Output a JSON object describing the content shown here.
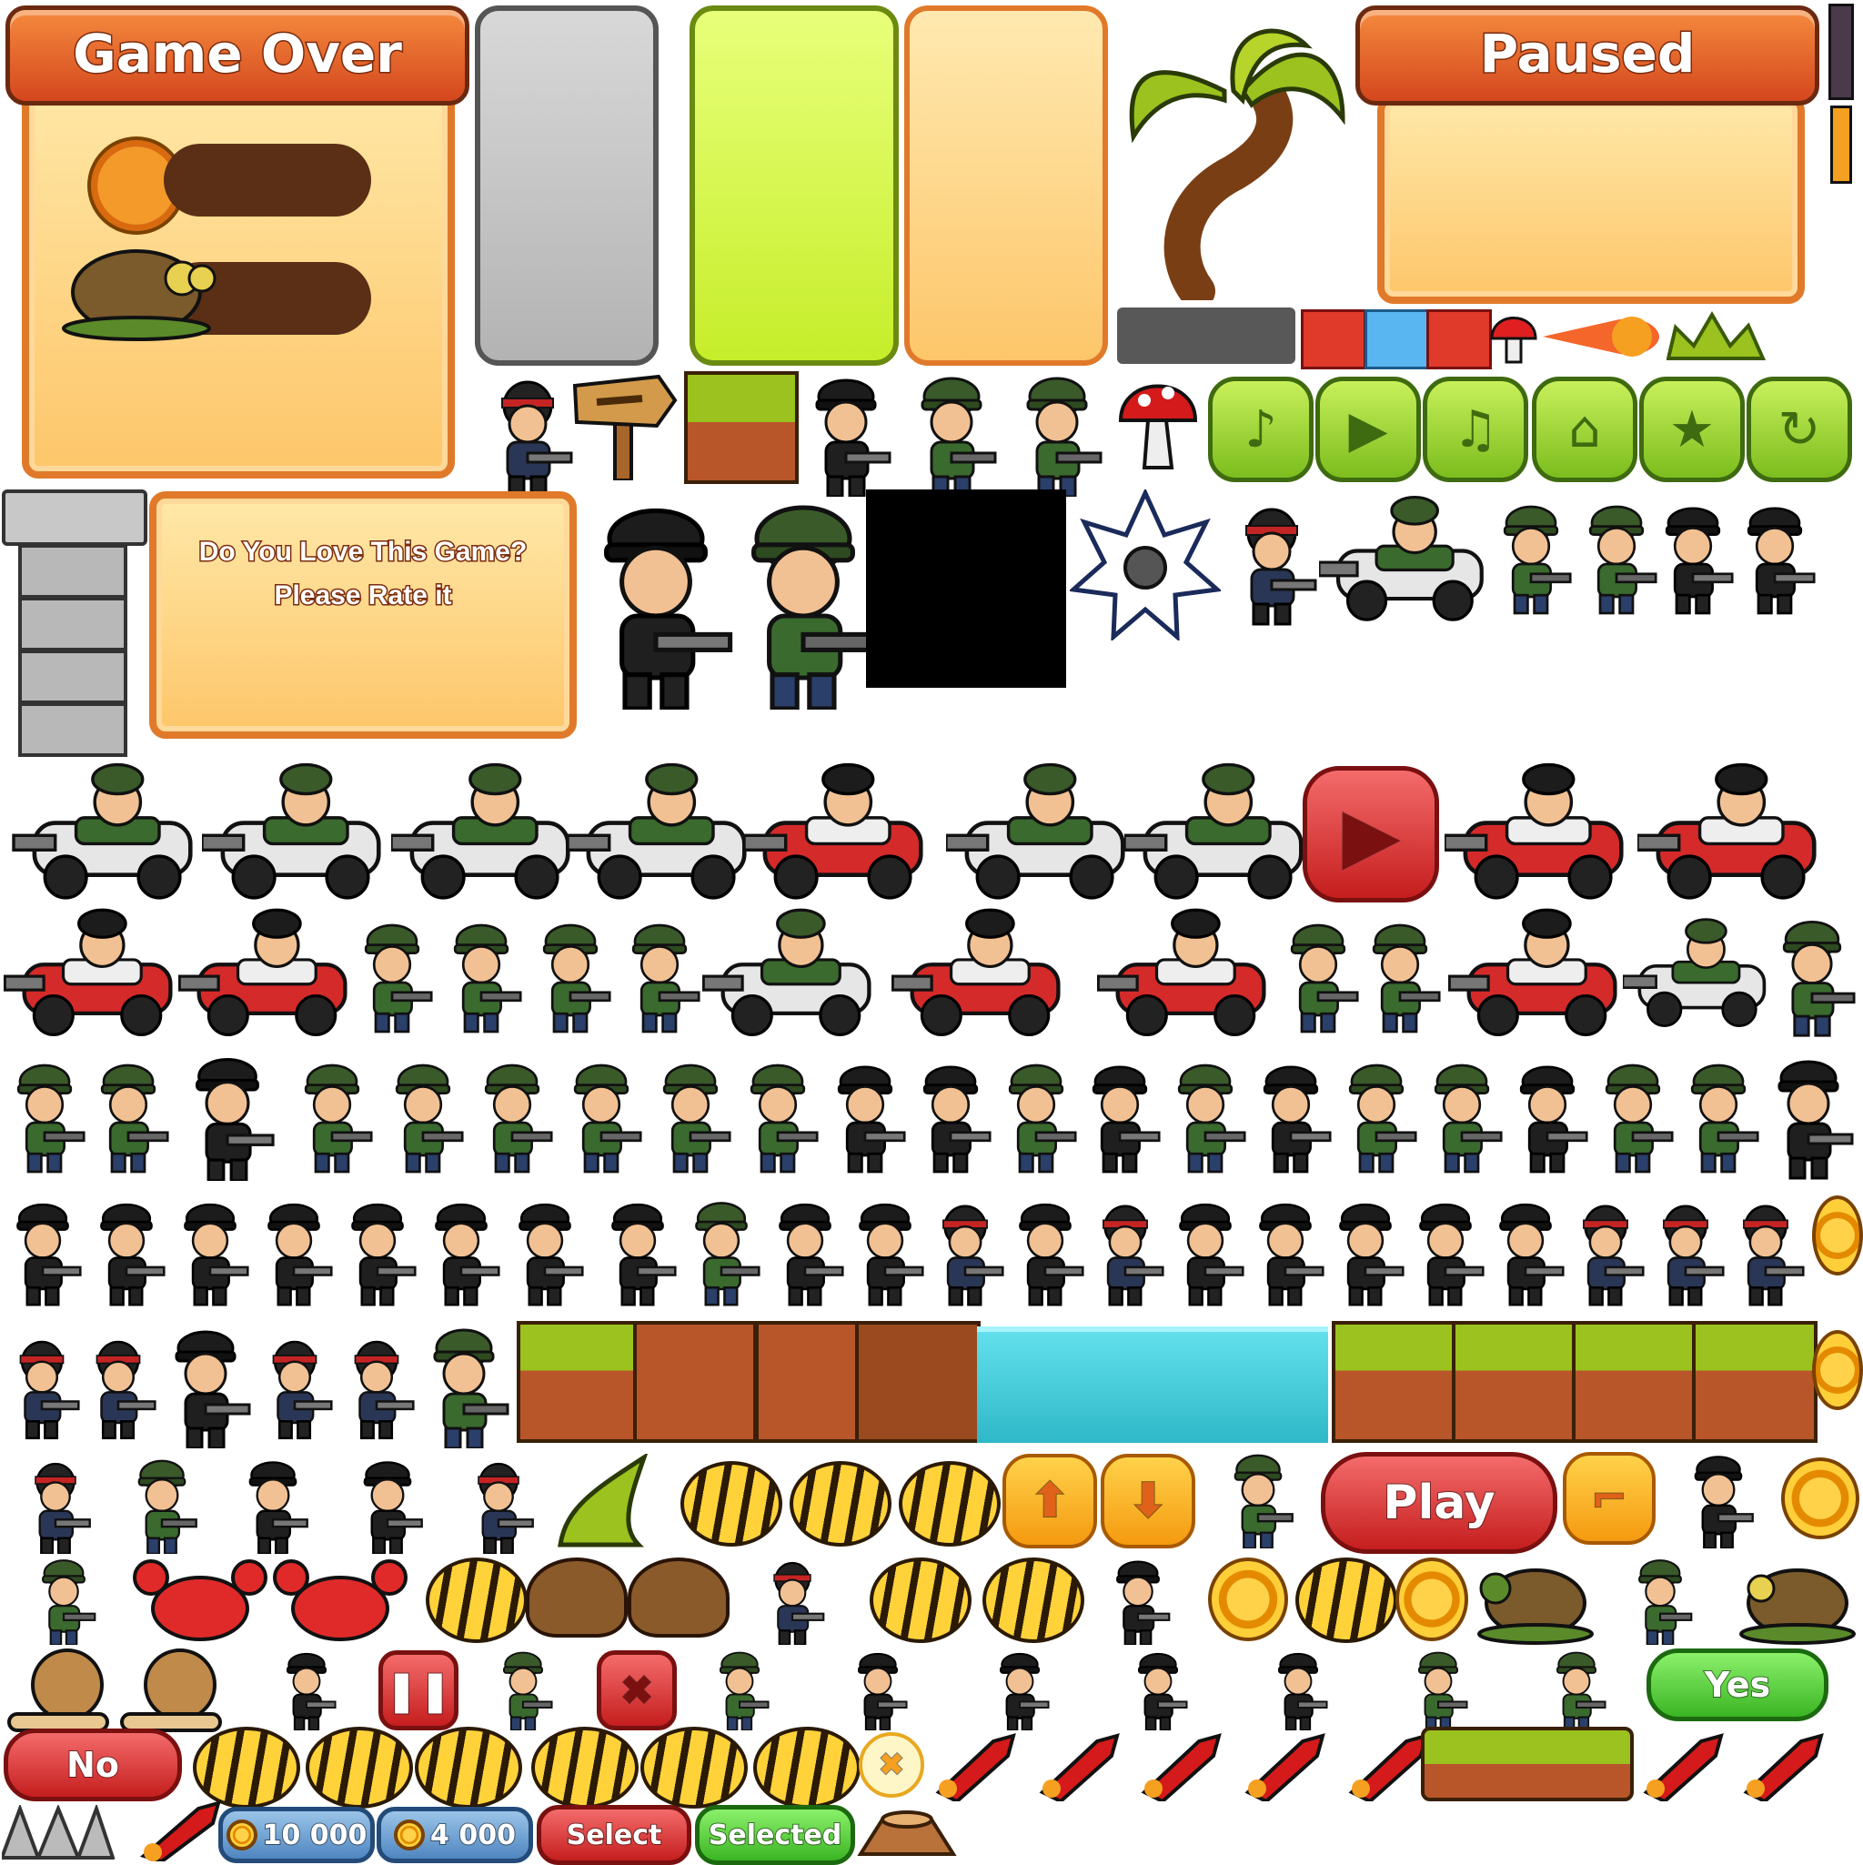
{
  "game_over_panel": {
    "title": "Game Over"
  },
  "paused_panel": {
    "title": "Paused"
  },
  "rate_panel": {
    "line1": "Do You Love This Game?",
    "line2": "Please Rate it"
  },
  "buttons": {
    "play": "Play",
    "yes": "Yes",
    "no": "No",
    "select": "Select",
    "selected": "Selected"
  },
  "prices": {
    "price1": "10 000",
    "price2": "4 000"
  },
  "icons": {
    "round_buttons": [
      "music-icon",
      "play-icon",
      "music-off-icon",
      "home-icon",
      "star-icon",
      "restart-icon"
    ],
    "colors": {
      "brand_orange": "#e2661f",
      "green_button": "#7cbd1e",
      "red_button": "#c51e1e",
      "water": "#3ec9d9",
      "dirt": "#a34a1e",
      "grass": "#9bc21e"
    }
  }
}
